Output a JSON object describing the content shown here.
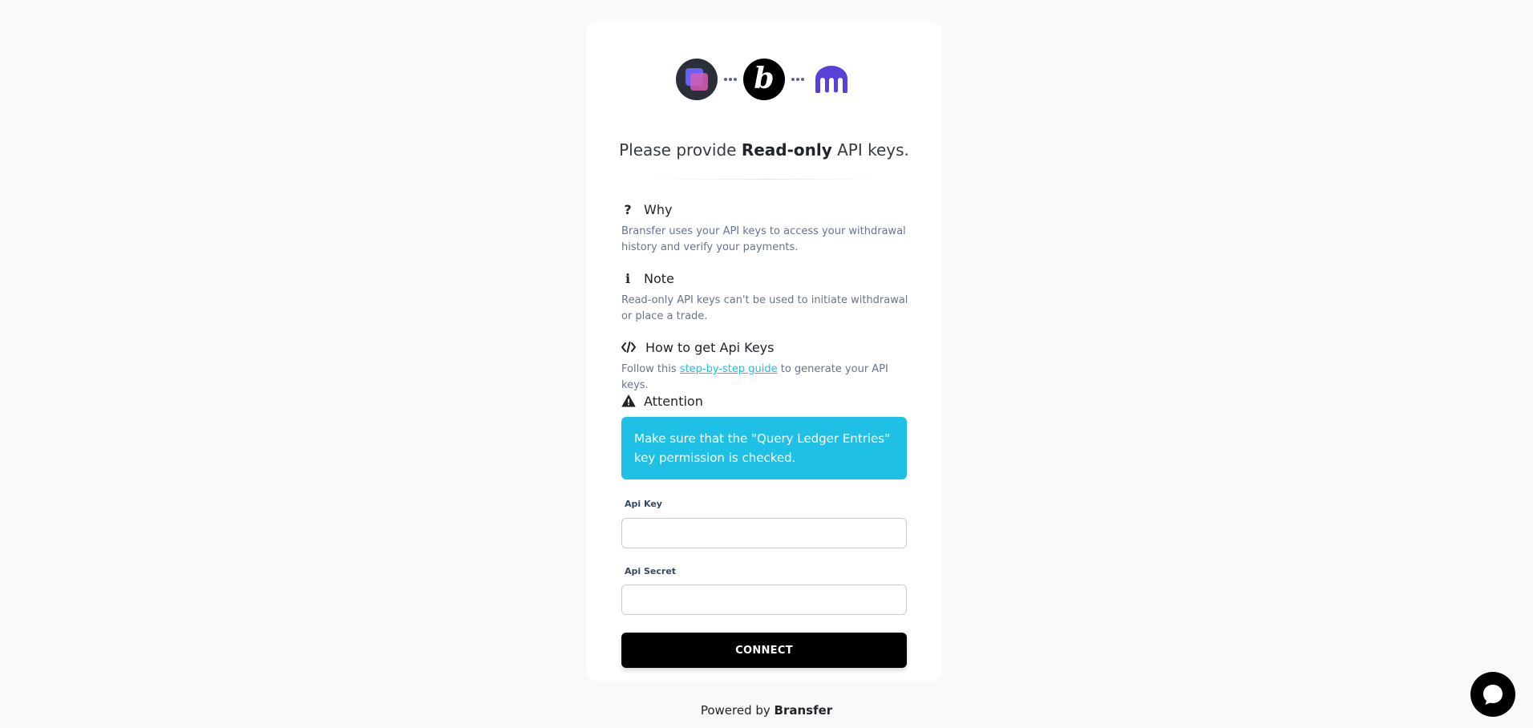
{
  "headline": {
    "prefix": "Please provide ",
    "emphasis": "Read-only",
    "suffix": " API keys."
  },
  "sections": {
    "why": {
      "icon": "question-icon",
      "title": "Why",
      "text": "Bransfer uses your API keys to access your withdrawal history and verify your payments."
    },
    "note": {
      "icon": "info-icon",
      "title": "Note",
      "text": "Read-only API keys can't be used to initiate withdrawal or place a trade."
    },
    "howto": {
      "icon": "code-icon",
      "title": "How to get Api Keys",
      "text_before": "Follow this ",
      "link": "step-by-step guide",
      "text_after": " to generate your API keys."
    },
    "attention": {
      "icon": "warning-icon",
      "title": "Attention",
      "alert": "Make sure that the \"Query Ledger Entries\" key permission is checked."
    }
  },
  "form": {
    "api_key_label": "Api Key",
    "api_key_value": "",
    "api_secret_label": "Api Secret",
    "api_secret_value": "",
    "submit_label": "CONNECT"
  },
  "footer": {
    "prefix": "Powered by ",
    "brand": "Bransfer"
  },
  "logos": {
    "first": "app-logo",
    "second": "bransfer-logo",
    "second_glyph": "b",
    "third": "kraken-logo"
  },
  "colors": {
    "accent": "#17c1e8",
    "alert_bg": "#1ec0e6",
    "button_bg": "#000000",
    "kraken": "#5741d9"
  }
}
